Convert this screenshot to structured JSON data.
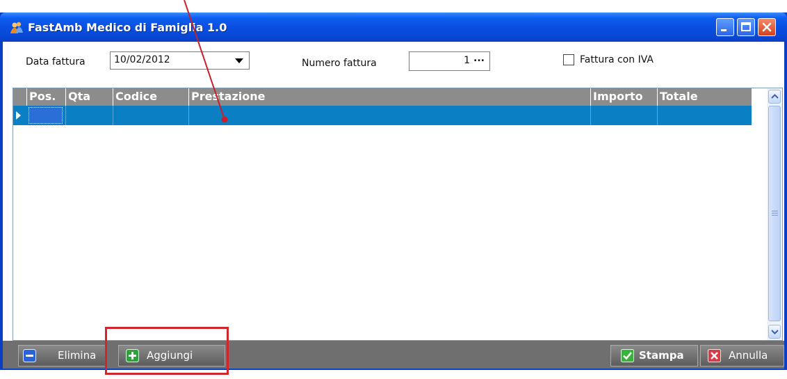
{
  "window": {
    "title": "FastAmb Medico di Famiglia 1.0",
    "app_icon": "people-icon",
    "controls": [
      "minimize-icon",
      "maximize-icon",
      "close-icon"
    ]
  },
  "form": {
    "data_fattura_label": "Data fattura",
    "data_fattura_value": "10/02/2012",
    "numero_fattura_label": "Numero fattura",
    "numero_fattura_value": "1",
    "numero_fattura_button": "...",
    "fattura_iva_label": "Fattura con IVA",
    "fattura_iva_checked": false
  },
  "grid": {
    "columns": [
      "Pos.",
      "Qta",
      "Codice",
      "Prestazione",
      "Importo",
      "Totale"
    ],
    "rows": [
      [
        "",
        "",
        "",
        "",
        "",
        ""
      ]
    ],
    "selected_row": 0
  },
  "toolbar": {
    "elimina_label": "Elimina",
    "aggiungi_label": "Aggiungi",
    "stampa_label": "Stampa",
    "annulla_label": "Annulla"
  },
  "colors": {
    "titlebar": "#0a4fe0",
    "selected_row": "#0a7fc4",
    "header": "#8c8c8c",
    "toolbar": "#6f6f6f",
    "annotation": "#d3262c"
  }
}
